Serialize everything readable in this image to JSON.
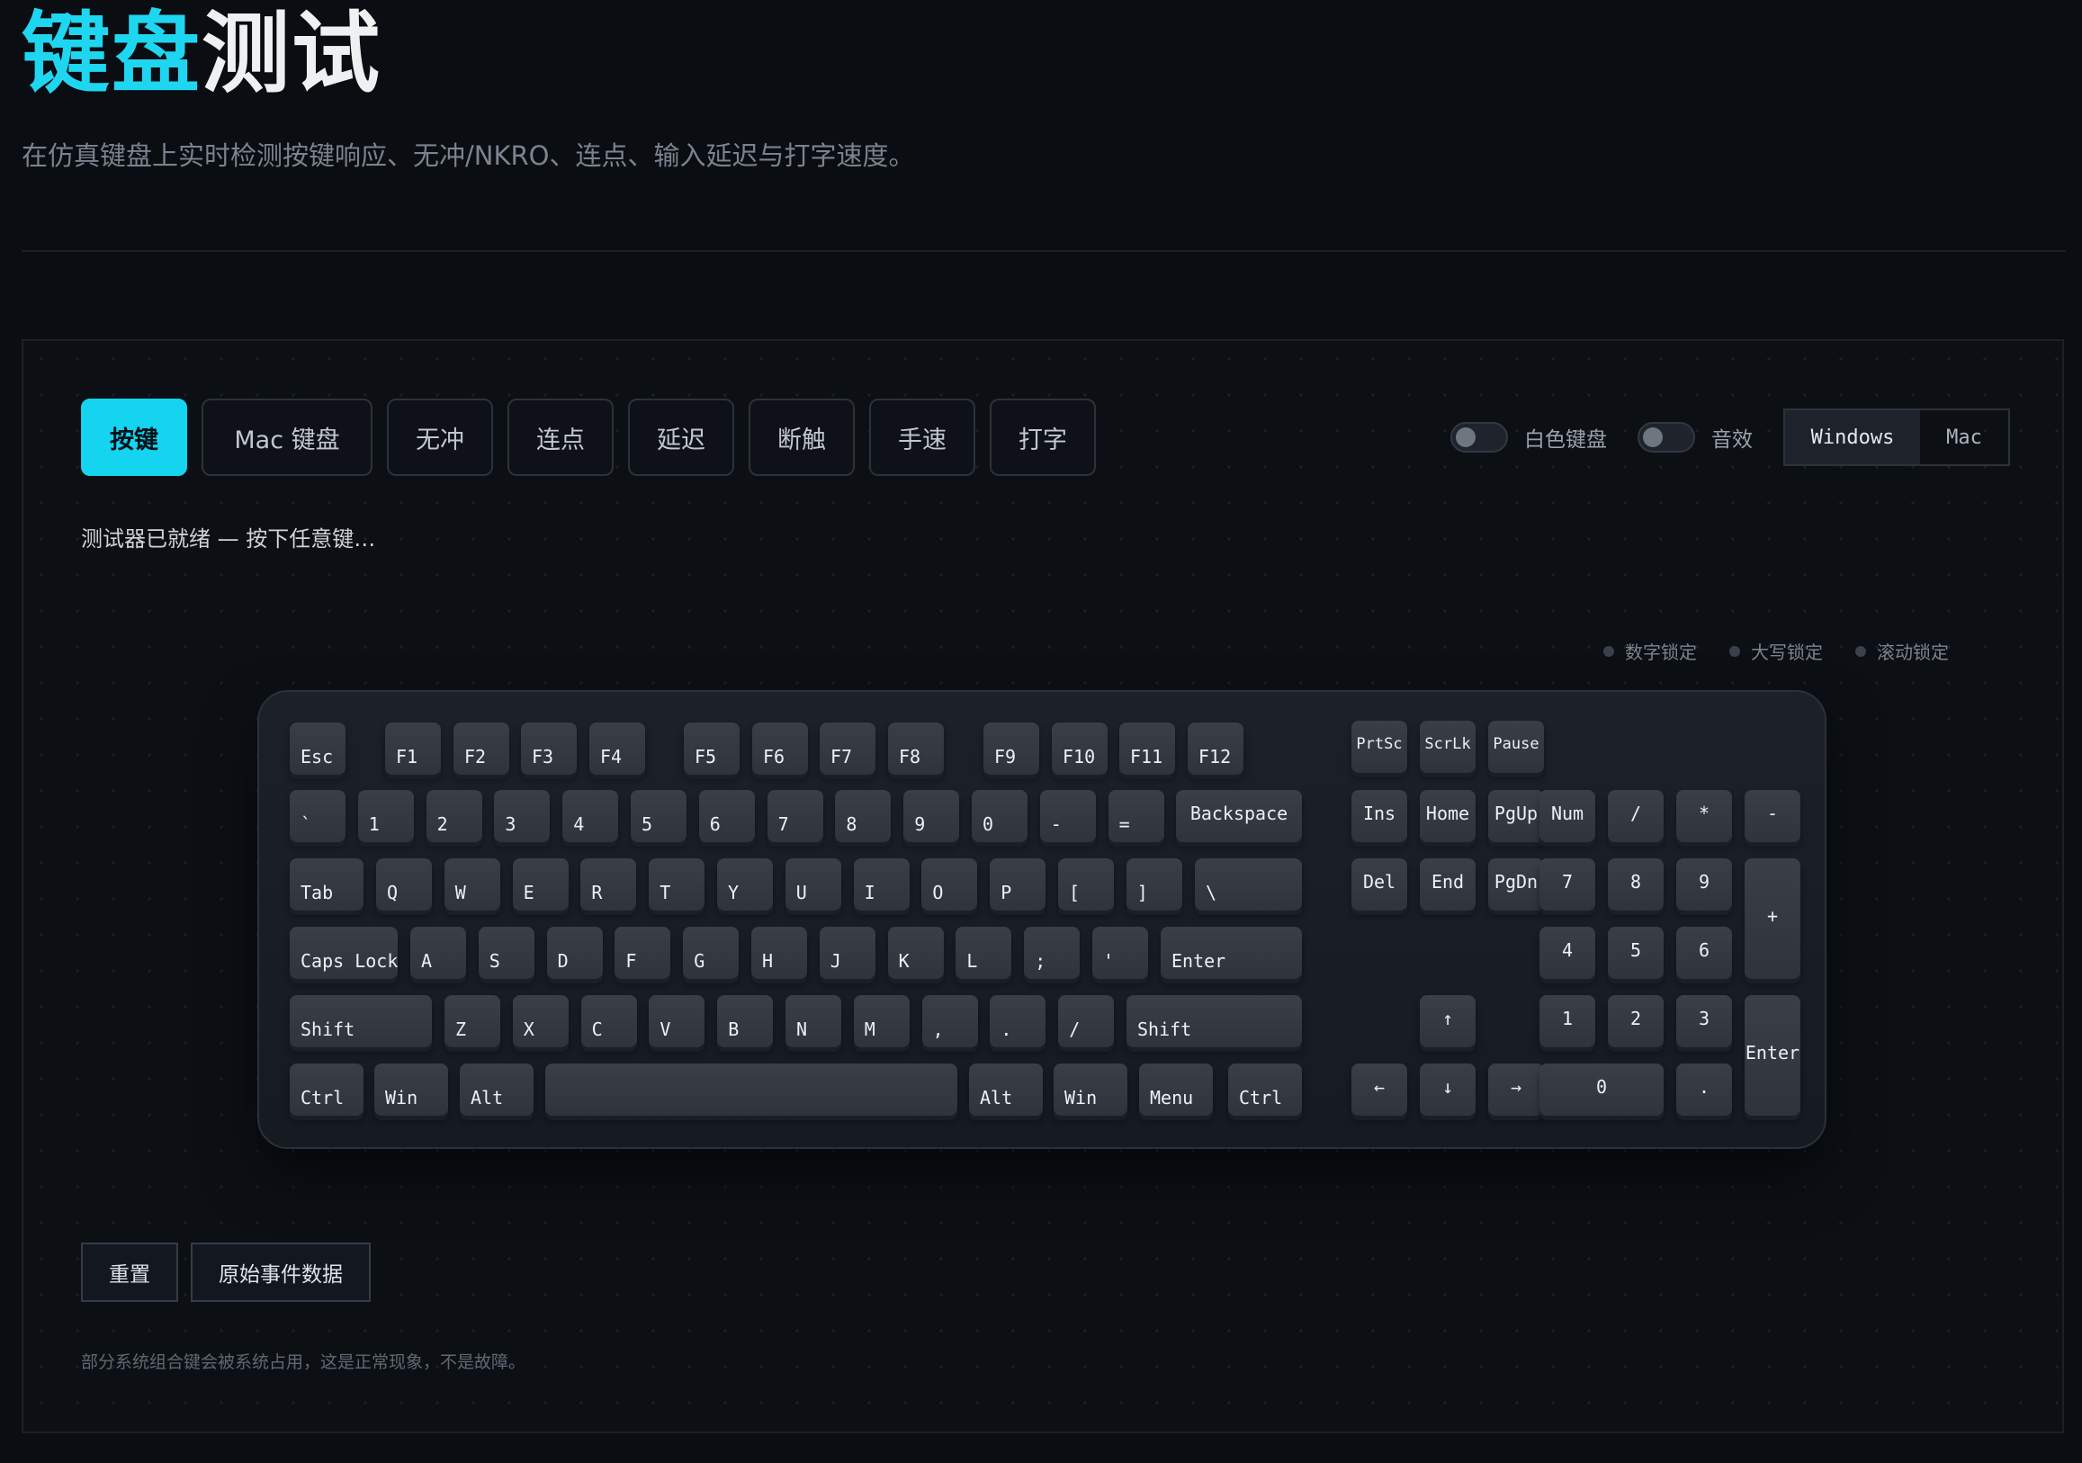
{
  "header": {
    "title_accent": "键盘",
    "title_rest": "测试",
    "subtitle": "在仿真键盘上实时检测按键响应、无冲/NKRO、连点、输入延迟与打字速度。"
  },
  "tabs": [
    "按键",
    "Mac 键盘",
    "无冲",
    "连点",
    "延迟",
    "断触",
    "手速",
    "打字"
  ],
  "active_tab": "按键",
  "toggles": {
    "white_keyboard": {
      "label": "白色键盘",
      "on": false
    },
    "sound": {
      "label": "音效",
      "on": false
    }
  },
  "os_options": [
    "Windows",
    "Mac"
  ],
  "os_selected": "Windows",
  "status": "测试器已就绪 — 按下任意键…",
  "locks": [
    "数字锁定",
    "大写锁定",
    "滚动锁定"
  ],
  "keyboard": {
    "function_row": [
      "Esc",
      "F1",
      "F2",
      "F3",
      "F4",
      "F5",
      "F6",
      "F7",
      "F8",
      "F9",
      "F10",
      "F11",
      "F12"
    ],
    "nav_top": [
      "PrtSc",
      "ScrLk",
      "Pause"
    ],
    "number_row": [
      "`",
      "1",
      "2",
      "3",
      "4",
      "5",
      "6",
      "7",
      "8",
      "9",
      "0",
      "-",
      "=",
      "Backspace"
    ],
    "nav_mid1": [
      "Ins",
      "Home",
      "PgUp"
    ],
    "numpad_row1": [
      "Num",
      "/",
      "*",
      "-"
    ],
    "tab_row": [
      "Tab",
      "Q",
      "W",
      "E",
      "R",
      "T",
      "Y",
      "U",
      "I",
      "O",
      "P",
      "[",
      "]",
      "\\"
    ],
    "nav_mid2": [
      "Del",
      "End",
      "PgDn"
    ],
    "numpad_row2": [
      "7",
      "8",
      "9",
      "+"
    ],
    "caps_row": [
      "Caps Lock",
      "A",
      "S",
      "D",
      "F",
      "G",
      "H",
      "J",
      "K",
      "L",
      ";",
      "'",
      "Enter"
    ],
    "numpad_row3": [
      "4",
      "5",
      "6"
    ],
    "shift_row": [
      "Shift",
      "Z",
      "X",
      "C",
      "V",
      "B",
      "N",
      "M",
      ",",
      ".",
      "/",
      "Shift"
    ],
    "arrow_up": "↑",
    "numpad_row4": [
      "1",
      "2",
      "3",
      "Enter"
    ],
    "bottom_row": [
      "Ctrl",
      "Win",
      "Alt",
      "",
      "Alt",
      "Win",
      "Menu",
      "Ctrl"
    ],
    "arrows_bottom": [
      "←",
      "↓",
      "→"
    ],
    "numpad_row5": [
      "0",
      "."
    ]
  },
  "actions": [
    "重置",
    "原始事件数据"
  ],
  "footer_note": "部分系统组合键会被系统占用，这是正常现象，不是故障。",
  "colors": {
    "accent": "#1fd6f0",
    "background": "#0a0d12"
  }
}
